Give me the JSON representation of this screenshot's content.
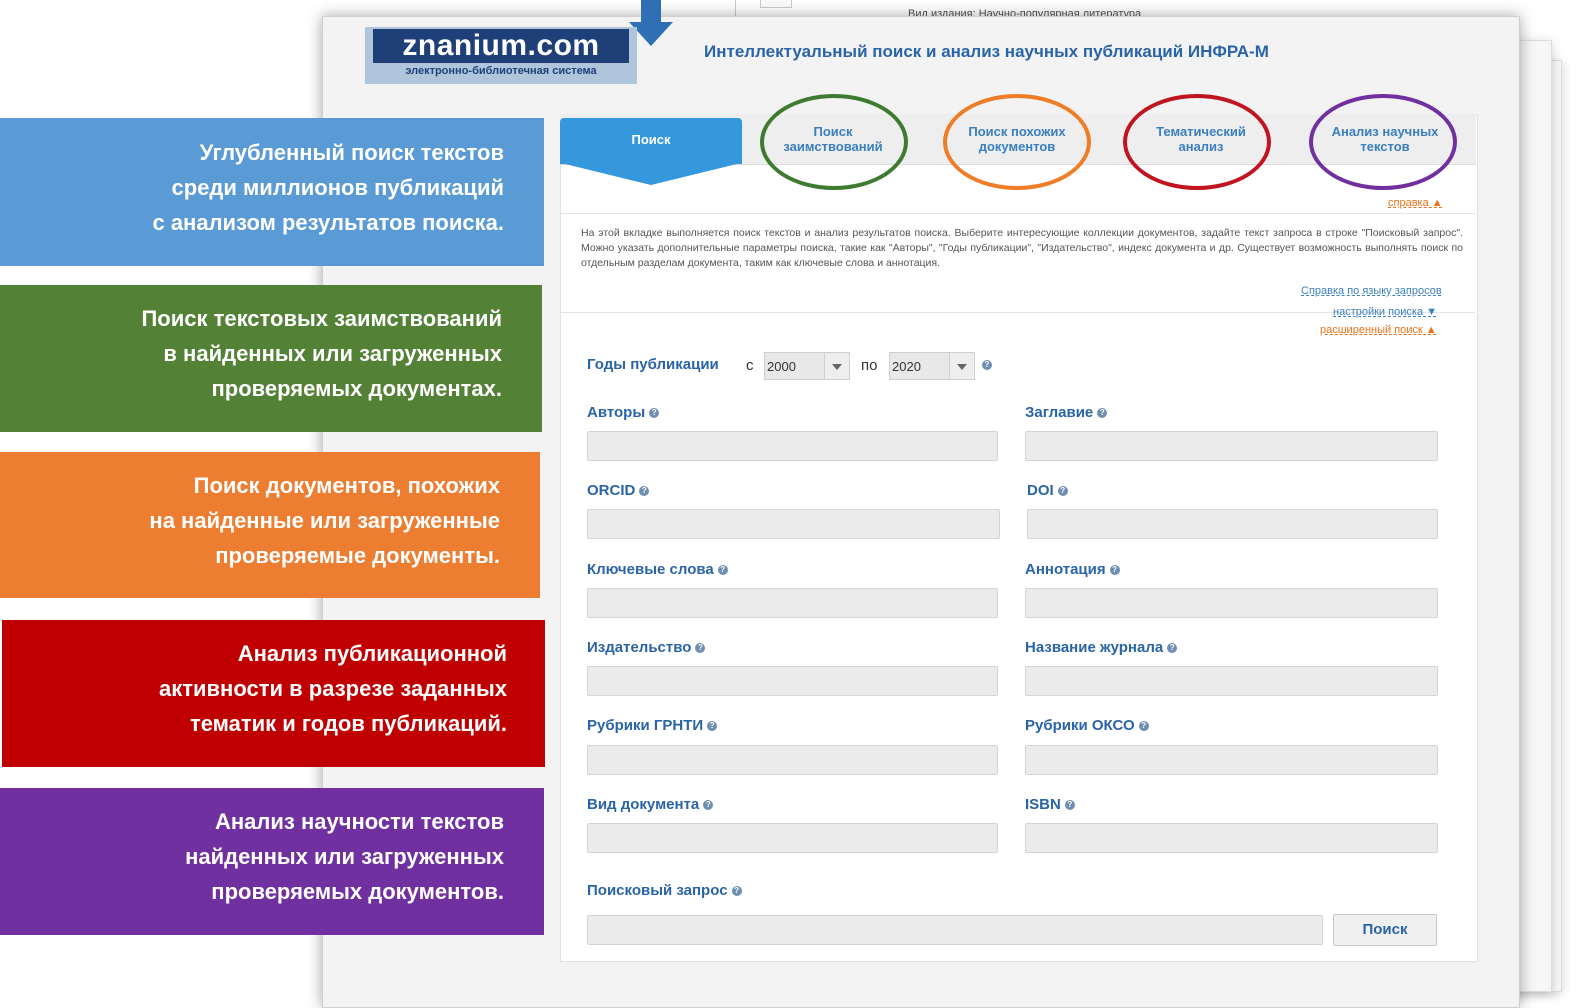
{
  "top_strip": {
    "text": "Вид издания: Научно-популярная литература"
  },
  "logo": {
    "brand": "znanium.com",
    "subtitle": "электронно-библиотечная система"
  },
  "header": {
    "title": "Интеллектуальный поиск и анализ научных публикаций ИНФРА-М"
  },
  "tabs": [
    {
      "label_1": "Поиск",
      "label_2": ""
    },
    {
      "label_1": "Поиск",
      "label_2": "заимствований",
      "ring_color": "#3e7a2f"
    },
    {
      "label_1": "Поиск похожих",
      "label_2": "документов",
      "ring_color": "#ef7c26"
    },
    {
      "label_1": "Тематический",
      "label_2": "анализ",
      "ring_color": "#c01520"
    },
    {
      "label_1": "Анализ научных",
      "label_2": "текстов",
      "ring_color": "#7030a0"
    }
  ],
  "help": {
    "toggle": "справка ▲",
    "text": "На этой вкладке выполняется поиск текстов и анализ результатов поиска. Выберите интересующие коллекции документов, задайте текст запроса в строке \"Поисковый запрос\". Можно указать дополнительные параметры поиска, такие как \"Авторы\", \"Годы публикации\", \"Издательство\", индекс документа и др. Существует возможность выполнять поиск по отдельным разделам документа, таким как ключевые слова и аннотация.",
    "query_language_link": "Справка по языку запросов",
    "search_settings_link": "настройки поиска ▼",
    "advanced_search_link": "расширенный поиск ▲"
  },
  "form": {
    "years_label": "Годы публикации",
    "from_label": "с",
    "to_label": "по",
    "year_from": "2000",
    "year_to": "2020",
    "fields": {
      "authors": "Авторы",
      "title": "Заглавие",
      "orcid": "ORCID",
      "doi": "DOI",
      "keywords": "Ключевые слова",
      "annotation": "Аннотация",
      "publisher": "Издательство",
      "journal": "Название журнала",
      "grnti": "Рубрики ГРНТИ",
      "okso": "Рубрики ОКСО",
      "doc_type": "Вид документа",
      "isbn": "ISBN",
      "query": "Поисковый запрос"
    },
    "search_button": "Поиск"
  },
  "callouts": [
    {
      "color": "#5b9bd5",
      "lines": [
        "Углубленный поиск текстов",
        "среди миллионов публикаций",
        "с анализом результатов поиска."
      ]
    },
    {
      "color": "#538135",
      "lines": [
        "Поиск текстовых заимствований",
        "в найденных или загруженных",
        "проверяемых документах."
      ]
    },
    {
      "color": "#ed7d31",
      "lines": [
        "Поиск документов, похожих",
        "на найденные или загруженные",
        "проверяемые документы."
      ]
    },
    {
      "color": "#c00000",
      "lines": [
        "Анализ публикационной",
        "активности в разрезе заданных",
        "тематик и годов публикаций."
      ]
    },
    {
      "color": "#7030a0",
      "lines": [
        "Анализ научности текстов",
        "найденных или загруженных",
        "проверяемых документов."
      ]
    }
  ]
}
